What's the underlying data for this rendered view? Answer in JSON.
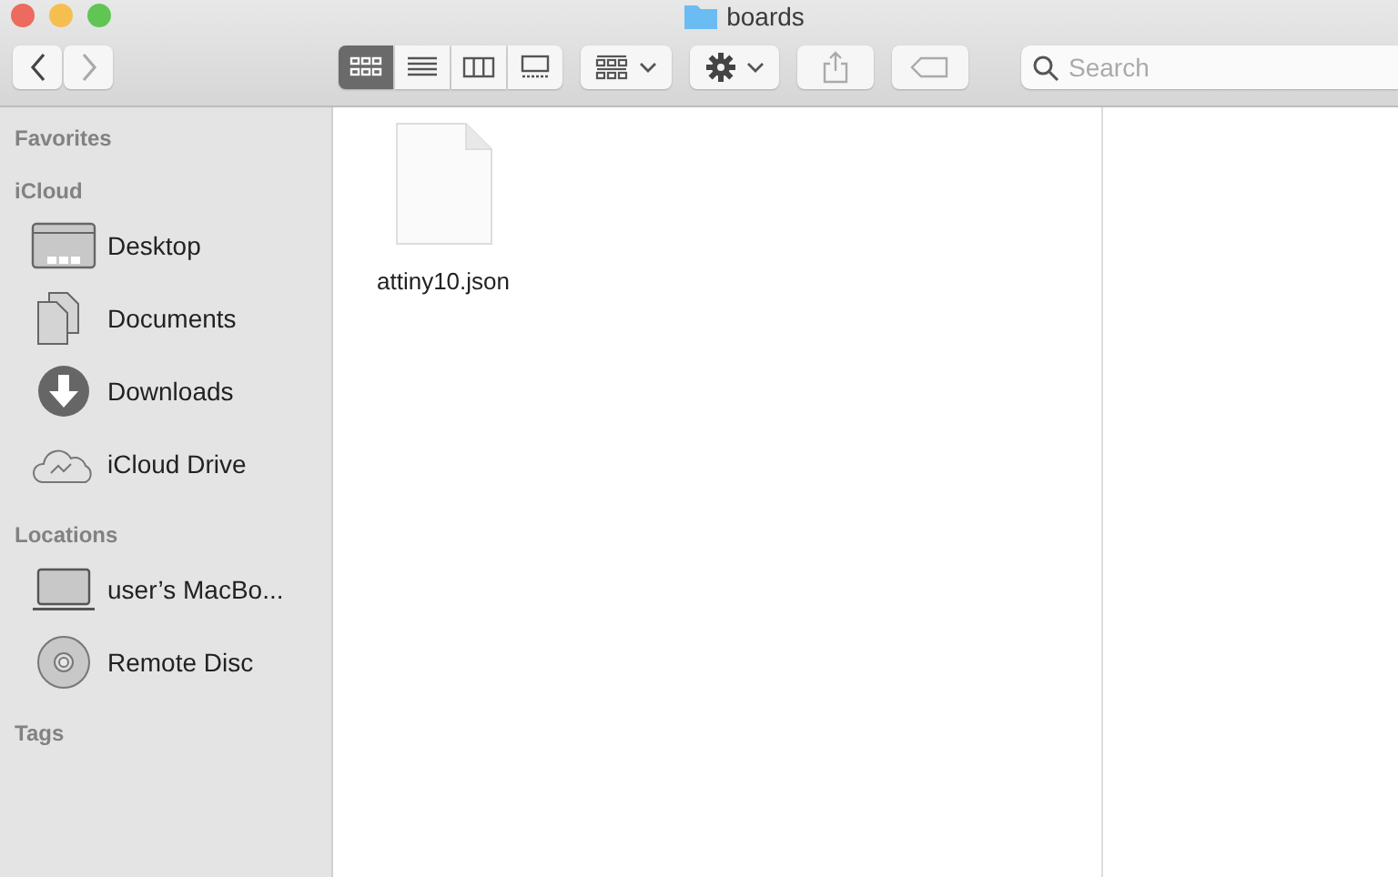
{
  "window": {
    "title": "boards"
  },
  "view_modes": [
    {
      "kind": "icons",
      "selected": true
    },
    {
      "kind": "list",
      "selected": false
    },
    {
      "kind": "columns",
      "selected": false
    },
    {
      "kind": "gallery",
      "selected": false
    }
  ],
  "search": {
    "placeholder": "Search"
  },
  "sidebar": {
    "sections": [
      {
        "label": "Favorites"
      },
      {
        "label": "iCloud",
        "items": [
          {
            "kind": "desktop",
            "label": "Desktop"
          },
          {
            "kind": "documents",
            "label": "Documents"
          },
          {
            "kind": "downloads",
            "label": "Downloads"
          },
          {
            "kind": "cloud",
            "label": "iCloud Drive"
          }
        ]
      },
      {
        "label": "Locations",
        "items": [
          {
            "kind": "laptop",
            "label": "user’s MacBo..."
          },
          {
            "kind": "disc",
            "label": "Remote Disc"
          }
        ]
      },
      {
        "label": "Tags"
      }
    ]
  },
  "files": [
    {
      "name": "attiny10.json"
    }
  ]
}
